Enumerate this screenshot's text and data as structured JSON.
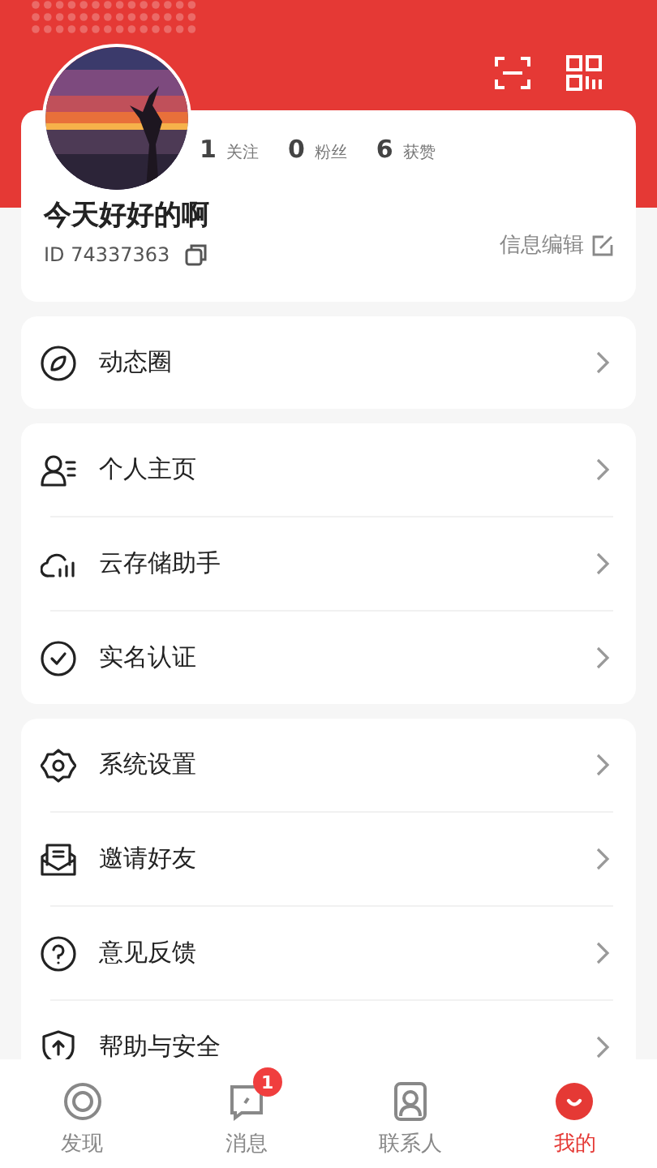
{
  "profile": {
    "name": "今天好好的啊",
    "id": "ID 74337363",
    "edit_label": "信息编辑",
    "stats": [
      {
        "count": "1",
        "label": "关注"
      },
      {
        "count": "0",
        "label": "粉丝"
      },
      {
        "count": "6",
        "label": "获赞"
      }
    ]
  },
  "menu_groups": [
    {
      "items": [
        {
          "label": "动态圈"
        }
      ]
    },
    {
      "items": [
        {
          "label": "个人主页"
        },
        {
          "label": "云存储助手"
        },
        {
          "label": "实名认证"
        }
      ]
    },
    {
      "items": [
        {
          "label": "系统设置"
        },
        {
          "label": "邀请好友"
        },
        {
          "label": "意见反馈"
        },
        {
          "label": "帮助与安全"
        }
      ]
    }
  ],
  "tabs": [
    {
      "label": "发现",
      "selected": false
    },
    {
      "label": "消息",
      "selected": false,
      "badge": "1"
    },
    {
      "label": "联系人",
      "selected": false
    },
    {
      "label": "我的",
      "selected": true
    }
  ]
}
